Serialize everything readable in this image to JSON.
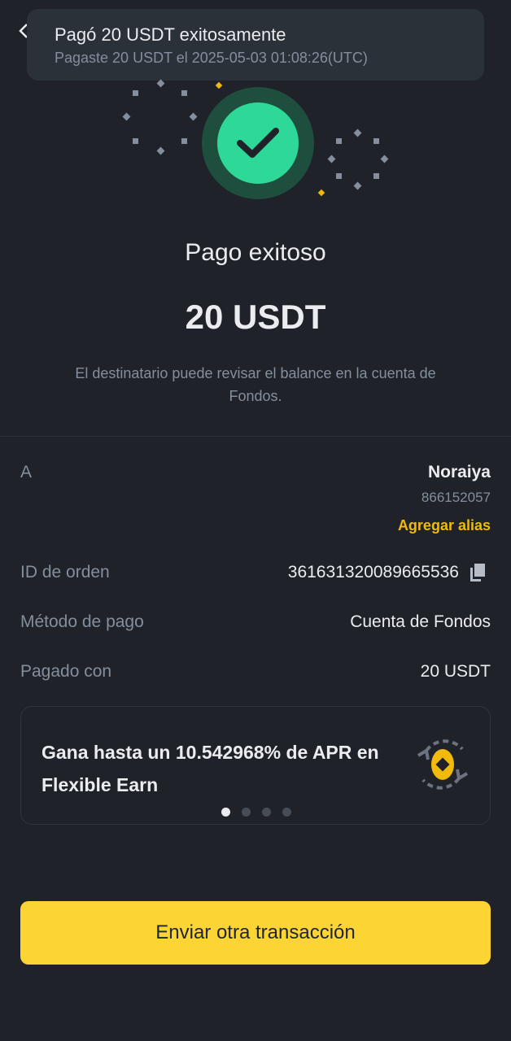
{
  "toast": {
    "title": "Pagó 20 USDT exitosamente",
    "subtitle": "Pagaste 20 USDT el 2025-05-03 01:08:26(UTC)"
  },
  "result": {
    "title": "Pago exitoso",
    "amount": "20 USDT",
    "note": "El destinatario puede revisar el balance en la cuenta de Fondos."
  },
  "details": {
    "recipient_label": "A",
    "recipient_name": "Noraiya",
    "recipient_id": "866152057",
    "add_alias": "Agregar alias",
    "order_label": "ID de orden",
    "order_id": "361631320089665536",
    "method_label": "Método de pago",
    "method_value": "Cuenta de Fondos",
    "paid_label": "Pagado con",
    "paid_value": "20 USDT"
  },
  "promo": {
    "text": "Gana hasta un 10.542968% de APR en Flexible Earn",
    "icon": "flexible-earn-coin-icon",
    "pages": 4,
    "active_page": 1
  },
  "cta": {
    "label": "Enviar otra transacción"
  },
  "colors": {
    "background": "#1f2329",
    "success": "#2ed898",
    "accent": "#fcd535",
    "link": "#f0b90b",
    "muted": "#848e9c"
  }
}
